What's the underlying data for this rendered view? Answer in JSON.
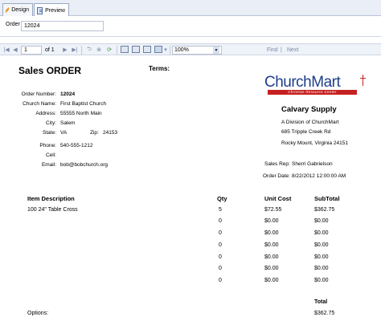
{
  "tabs": [
    {
      "label": "Design",
      "icon": "pencil-icon"
    },
    {
      "label": "Preview",
      "icon": "preview-icon"
    }
  ],
  "parameters": {
    "label": "Order",
    "value": "12024"
  },
  "toolbar": {
    "page_value": "1",
    "page_of": "of 1",
    "zoom": "100%",
    "find_label": "Find",
    "separator": "|",
    "next_label": "Next"
  },
  "report": {
    "title": "Sales ORDER",
    "terms_label": "Terms:",
    "order_number_label": "Order Number:",
    "order_number": "12024",
    "church_name_label": "Church Name:",
    "church_name": "First Baptist Church",
    "address_label": "Address:",
    "address": "55555 North Main",
    "city_label": "City:",
    "city": "Salem",
    "state_label": "State:",
    "state": "VA",
    "zip_label": "Zip:",
    "zip": "24153",
    "phone_label": "Phone:",
    "phone": "540-555-1212",
    "cell_label": "Cell:",
    "cell": "",
    "email_label": "Email:",
    "email": "bob@bobchurch.org",
    "logo_text": "ChurchMart",
    "logo_tagline": "Christian Resource Center",
    "company_name": "Calvary Supply",
    "company_division": "A Division of ChurchMart",
    "company_street": "685 Tripple Creek Rd",
    "company_city": "Rocky Mount, Virginia 24151",
    "sales_rep_label": "Sales Rep:",
    "sales_rep": "Sherri Gabrielson",
    "order_date_label": "Order Date:",
    "order_date": "8/22/2012 12:00:00 AM",
    "columns": {
      "item": "Item Description",
      "qty": "Qty",
      "unit_cost": "Unit Cost",
      "subtotal": "SubTotal"
    },
    "line_items": [
      {
        "item": "100 24\" Table Cross",
        "qty": "5",
        "unit_cost": "$72.55",
        "subtotal": "$362.75"
      },
      {
        "item": "",
        "qty": "0",
        "unit_cost": "$0.00",
        "subtotal": "$0.00"
      },
      {
        "item": "",
        "qty": "0",
        "unit_cost": "$0.00",
        "subtotal": "$0.00"
      },
      {
        "item": "",
        "qty": "0",
        "unit_cost": "$0.00",
        "subtotal": "$0.00"
      },
      {
        "item": "",
        "qty": "0",
        "unit_cost": "$0.00",
        "subtotal": "$0.00"
      },
      {
        "item": "",
        "qty": "0",
        "unit_cost": "$0.00",
        "subtotal": "$0.00"
      },
      {
        "item": "",
        "qty": "0",
        "unit_cost": "$0.00",
        "subtotal": "$0.00"
      }
    ],
    "total_label": "Total",
    "options_label": "Options:",
    "total_value": "$362.75"
  },
  "colors": {
    "logo_blue": "#1e3e8a",
    "logo_red": "#c52020",
    "toolbar_bg": "#eef2f9",
    "tab_bg": "#e9eef7"
  }
}
